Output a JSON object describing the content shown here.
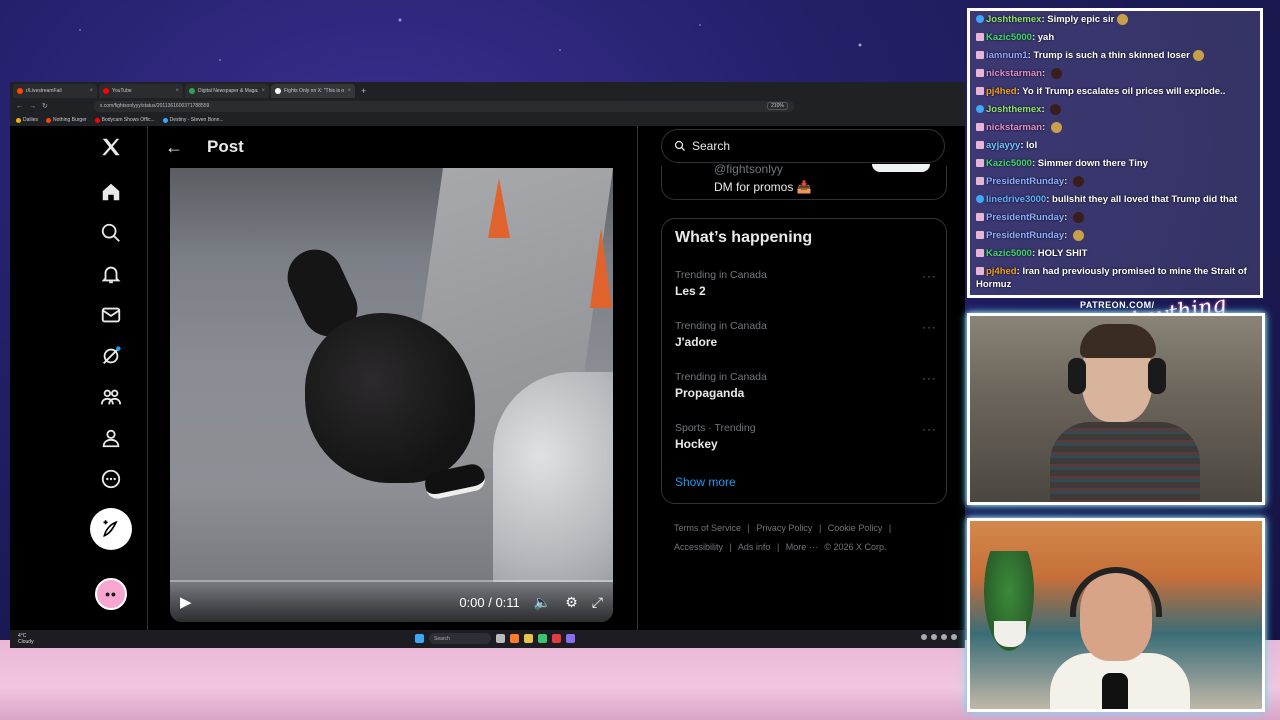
{
  "browser": {
    "tabs": [
      {
        "title": "r/LivestreamFail",
        "color": "#ff4500",
        "active": false
      },
      {
        "title": "YouTube",
        "color": "#ff0000",
        "active": false
      },
      {
        "title": "Digital Newspaper & Magazine",
        "color": "#2ea44f",
        "active": false
      },
      {
        "title": "Fights Only on X: \"This is one o",
        "color": "#ffffff",
        "active": true
      }
    ],
    "url": "x.com/fightsonlyyy/status/2011361600371788559",
    "zoom": "210%",
    "bookmarks": [
      "Dailies",
      "Nothing Burger",
      "Bodycam Shows Offic...",
      "Destiny - Steven Bonn..."
    ]
  },
  "x": {
    "post_title": "Post",
    "video": {
      "time": "0:00 / 0:11",
      "progress": 0.0
    },
    "search_label": "Search",
    "promo": {
      "handle": "@fightsonlyy",
      "dm_text": "DM for promos 📥"
    },
    "whats_happening": {
      "title": "What’s happening",
      "trends": [
        {
          "context": "Trending in Canada",
          "name": "Les 2"
        },
        {
          "context": "Trending in Canada",
          "name": "J'adore"
        },
        {
          "context": "Trending in Canada",
          "name": "Propaganda"
        },
        {
          "context": "Sports · Trending",
          "name": "Hockey"
        }
      ],
      "show_more": "Show more"
    },
    "footer": {
      "links": [
        "Terms of Service",
        "|",
        "Privacy Policy",
        "|",
        "Cookie Policy",
        "|",
        "Accessibility",
        "|",
        "Ads info",
        "|",
        "More ···",
        "© 2026 X Corp."
      ]
    },
    "avatar_text": "••"
  },
  "taskbar": {
    "weather_temp": "4°C",
    "weather_desc": "Cloudy",
    "search": "Search"
  },
  "chat": [
    {
      "user": "Joshthemex",
      "color": "#8fe36a",
      "msg": "Simply epic sir",
      "emote": true
    },
    {
      "user": "Kazic5000",
      "color": "#3fd86e",
      "msg": "yah"
    },
    {
      "user": "iamnum1",
      "color": "#8fa6ff",
      "msg": "Trump is such a thin skinned loser",
      "emote": true
    },
    {
      "user": "nickstarman",
      "color": "#e08cc8",
      "msg": "",
      "emote": true
    },
    {
      "user": "pj4hed",
      "color": "#f0a020",
      "msg": "Yo if Trump escalates oil prices will explode.."
    },
    {
      "user": "Joshthemex",
      "color": "#8fe36a",
      "msg": "",
      "emote": true
    },
    {
      "user": "nickstarman",
      "color": "#e08cc8",
      "msg": "",
      "emote": true
    },
    {
      "user": "ayjayyy",
      "color": "#6ec2ff",
      "msg": "lol"
    },
    {
      "user": "Kazic5000",
      "color": "#3fd86e",
      "msg": "Simmer down there Tiny"
    },
    {
      "user": "PresidentRunday",
      "color": "#8ab0ff",
      "msg": "",
      "emote": true
    },
    {
      "user": "linedrive3000",
      "color": "#5fb0ff",
      "msg": "bullshit they all loved that Trump did that"
    },
    {
      "user": "PresidentRunday",
      "color": "#8ab0ff",
      "msg": "",
      "emote": true
    },
    {
      "user": "PresidentRunday",
      "color": "#8ab0ff",
      "msg": "",
      "emote": true
    },
    {
      "user": "Kazic5000",
      "color": "#3fd86e",
      "msg": "HOLY SHIT"
    },
    {
      "user": "pj4hed",
      "color": "#f0a020",
      "msg": "Iran had previously promised to mine the Strait of Hormuz"
    }
  ],
  "overlay": {
    "patreon": "PATREON.COM/",
    "signature": "Anything Else?"
  }
}
